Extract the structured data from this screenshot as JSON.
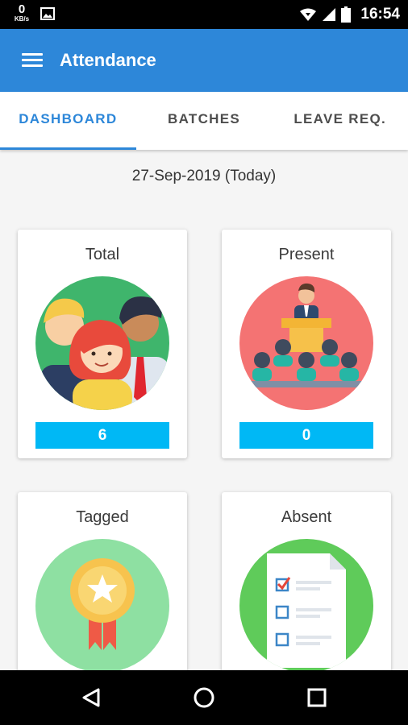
{
  "status_bar": {
    "net_speed": "0",
    "net_unit": "KB/s",
    "time": "16:54",
    "icons": [
      "image-icon",
      "wifi-icon",
      "signal-icon",
      "battery-icon"
    ]
  },
  "app_bar": {
    "title": "Attendance",
    "color": "#2d87d9",
    "menu_icon": "hamburger-menu-icon"
  },
  "tabs": [
    {
      "label": "DASHBOARD",
      "active": true
    },
    {
      "label": "BATCHES",
      "active": false
    },
    {
      "label": "LEAVE REQ.",
      "active": false
    }
  ],
  "date_label": "27-Sep-2019 (Today)",
  "cards": [
    {
      "title": "Total",
      "count": "6",
      "icon": "group-of-people-icon"
    },
    {
      "title": "Present",
      "count": "0",
      "icon": "presenter-audience-icon"
    },
    {
      "title": "Tagged",
      "icon": "award-ribbon-icon"
    },
    {
      "title": "Absent",
      "icon": "checklist-document-icon"
    }
  ],
  "colors": {
    "count_bar": "#00b8f5",
    "total_circle": "#3fb56c",
    "present_circle": "#f47373",
    "tagged_circle": "#8ee0a2",
    "absent_circle": "#5fcb5a"
  },
  "nav_bar": {
    "icons": [
      "back-triangle-icon",
      "home-circle-icon",
      "recents-square-icon"
    ]
  }
}
